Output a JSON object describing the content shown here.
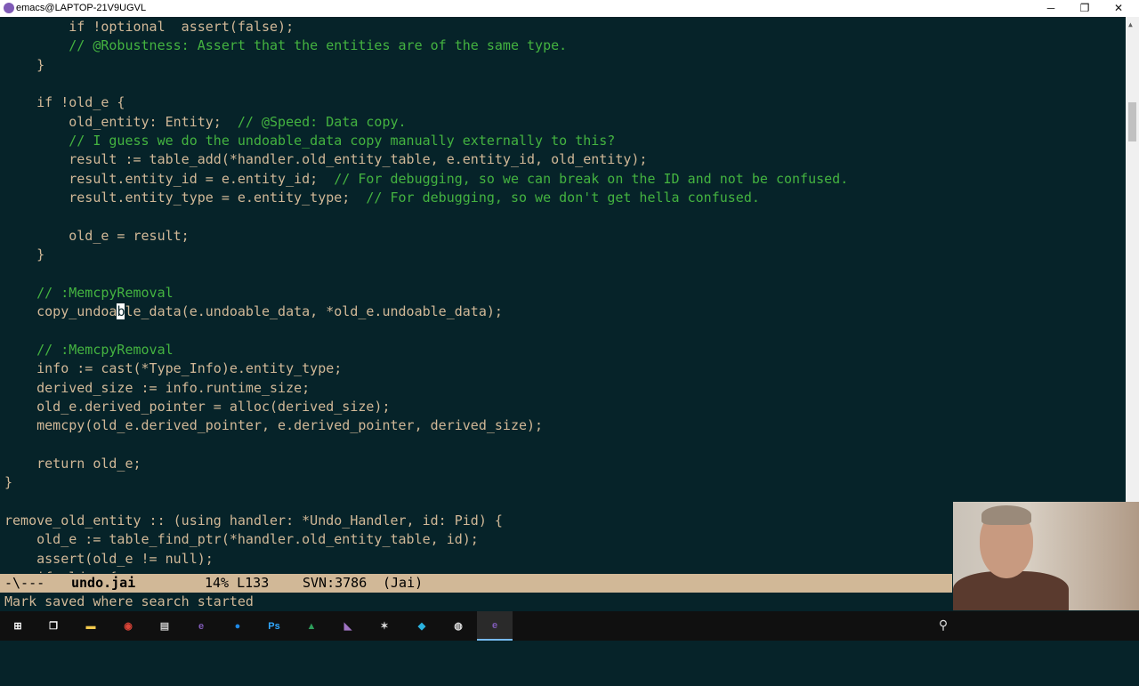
{
  "window": {
    "title": "emacs@LAPTOP-21V9UGVL",
    "controls": {
      "minimize": "─",
      "maximize": "❐",
      "close": "✕"
    }
  },
  "colors": {
    "background": "#062329",
    "code": "#d1b897",
    "comment": "#44b340",
    "modeline_bg": "#d1b897"
  },
  "editor": {
    "lines": [
      [
        {
          "t": "        if !optional  assert(false);",
          "c": "code"
        }
      ],
      [
        {
          "t": "        ",
          "c": "code"
        },
        {
          "t": "// @Robustness: Assert that the entities are of the same type.",
          "c": "comment"
        }
      ],
      [
        {
          "t": "    }",
          "c": "code"
        }
      ],
      [],
      [
        {
          "t": "    if !old_e {",
          "c": "code"
        }
      ],
      [
        {
          "t": "        old_entity: Entity;  ",
          "c": "code"
        },
        {
          "t": "// @Speed: Data copy.",
          "c": "comment"
        }
      ],
      [
        {
          "t": "        ",
          "c": "code"
        },
        {
          "t": "// I guess we do the undoable_data copy manually externally to this?",
          "c": "comment"
        }
      ],
      [
        {
          "t": "        result := table_add(*handler.old_entity_table, e.entity_id, old_entity);",
          "c": "code"
        }
      ],
      [
        {
          "t": "        result.entity_id = e.entity_id;  ",
          "c": "code"
        },
        {
          "t": "// For debugging, so we can break on the ID and not be confused.",
          "c": "comment"
        }
      ],
      [
        {
          "t": "        result.entity_type = e.entity_type;  ",
          "c": "code"
        },
        {
          "t": "// For debugging, so we don't get hella confused.",
          "c": "comment"
        }
      ],
      [],
      [
        {
          "t": "        old_e = result;",
          "c": "code"
        }
      ],
      [
        {
          "t": "    }",
          "c": "code"
        }
      ],
      [],
      [
        {
          "t": "    ",
          "c": "code"
        },
        {
          "t": "// :MemcpyRemoval",
          "c": "comment"
        }
      ],
      [
        {
          "t": "    copy_undoa",
          "c": "code"
        },
        {
          "t": "b",
          "c": "cursor"
        },
        {
          "t": "le_data(e.undoable_data, *old_e.undoable_data);",
          "c": "code"
        }
      ],
      [],
      [
        {
          "t": "    ",
          "c": "code"
        },
        {
          "t": "// :MemcpyRemoval",
          "c": "comment"
        }
      ],
      [
        {
          "t": "    info := cast(*Type_Info)e.entity_type;",
          "c": "code"
        }
      ],
      [
        {
          "t": "    derived_size := info.runtime_size;",
          "c": "code"
        }
      ],
      [
        {
          "t": "    old_e.derived_pointer = alloc(derived_size);",
          "c": "code"
        }
      ],
      [
        {
          "t": "    memcpy(old_e.derived_pointer, e.derived_pointer, derived_size);",
          "c": "code"
        }
      ],
      [],
      [
        {
          "t": "    return old_e;",
          "c": "code"
        }
      ],
      [
        {
          "t": "}",
          "c": "code"
        }
      ],
      [],
      [
        {
          "t": "remove_old_entity :: (using handler: *Undo_Handler, id: Pid) {",
          "c": "code"
        }
      ],
      [
        {
          "t": "    old_e := table_find_ptr(*handler.old_entity_table, id);",
          "c": "code"
        }
      ],
      [
        {
          "t": "    assert(old_e != null);",
          "c": "code"
        }
      ],
      [
        {
          "t": "    if old_e {",
          "c": "code"
        }
      ]
    ]
  },
  "modeline": {
    "status": "-\\---",
    "buffer": "undo.jai",
    "position": "14% L133",
    "vc": "SVN:3786",
    "mode": "(Jai)"
  },
  "echo_area": "Mark saved where search started",
  "taskbar": {
    "items": [
      {
        "name": "windows-start-icon",
        "glyph": "⊞",
        "color": "#ffffff"
      },
      {
        "name": "task-view-icon",
        "glyph": "❐",
        "color": "#ffffff"
      },
      {
        "name": "file-explorer-icon",
        "glyph": "▬",
        "color": "#f2c94c"
      },
      {
        "name": "chrome-icon",
        "glyph": "◉",
        "color": "#db4437"
      },
      {
        "name": "terminal-icon",
        "glyph": "▤",
        "color": "#cccccc"
      },
      {
        "name": "emacs-icon",
        "glyph": "e",
        "color": "#7f5ab6"
      },
      {
        "name": "blue-circle-app-icon",
        "glyph": "●",
        "color": "#1e88e5"
      },
      {
        "name": "photoshop-icon",
        "glyph": "Ps",
        "color": "#31a8ff"
      },
      {
        "name": "green-app-icon",
        "glyph": "▲",
        "color": "#2e9e5b"
      },
      {
        "name": "visual-studio-icon",
        "glyph": "◣",
        "color": "#a074c4"
      },
      {
        "name": "settings-app-icon",
        "glyph": "✶",
        "color": "#dddddd"
      },
      {
        "name": "blue-app-icon",
        "glyph": "◆",
        "color": "#2bb3e0"
      },
      {
        "name": "obs-icon",
        "glyph": "◍",
        "color": "#dddddd"
      },
      {
        "name": "emacs-active-icon",
        "glyph": "e",
        "color": "#7f5ab6"
      }
    ],
    "tray_icon": "⚲"
  }
}
